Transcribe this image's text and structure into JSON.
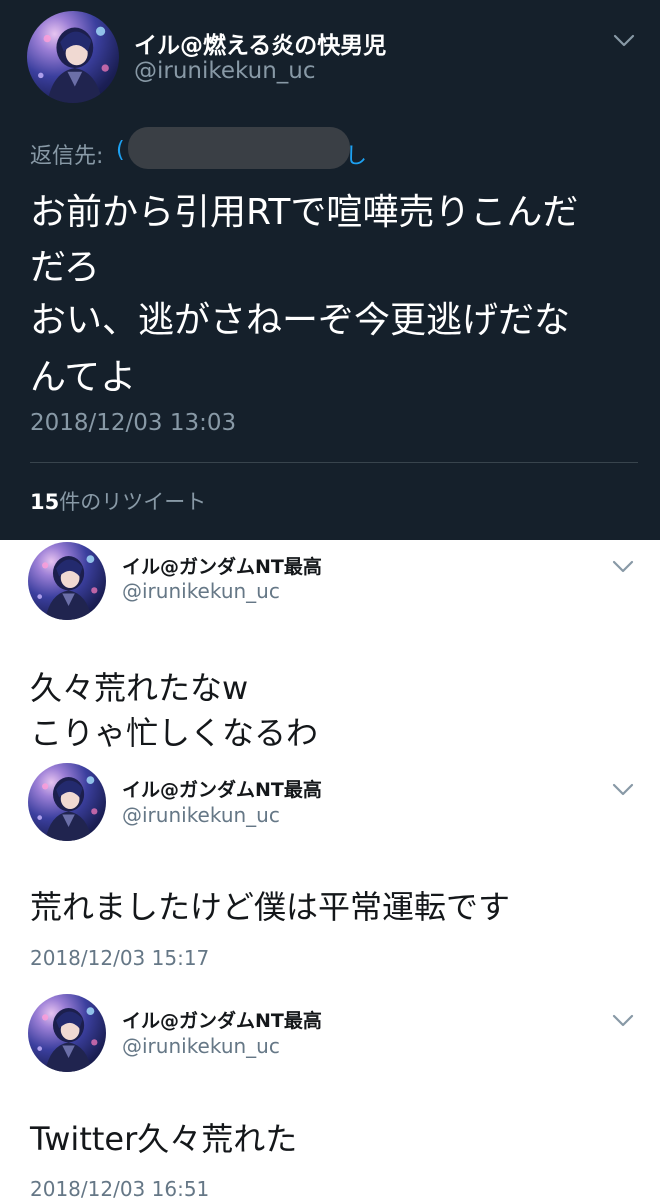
{
  "tweets": [
    {
      "display_name": "イル@燃える炎の快男児",
      "handle": "@irunikekun_uc",
      "reply_label": "返信先:",
      "reply_paren_open": "(",
      "reply_end": "し",
      "lines": [
        "お前から引用RTで喧嘩売りこんだ",
        "だろ",
        "おい、逃がさねーぞ今更逃げだな",
        "んてよ"
      ],
      "timestamp": "2018/12/03 13:03",
      "retweet_count": "15",
      "retweet_label": "件のリツイート"
    },
    {
      "display_name": "イル@ガンダムNT最高",
      "handle": "@irunikekun_uc",
      "lines": [
        "久々荒れたなw",
        "こりゃ忙しくなるわ"
      ]
    },
    {
      "display_name": "イル@ガンダムNT最高",
      "handle": "@irunikekun_uc",
      "lines": [
        "荒れましたけど僕は平常運転です"
      ],
      "timestamp": "2018/12/03 15:17"
    },
    {
      "display_name": "イル@ガンダムNT最高",
      "handle": "@irunikekun_uc",
      "lines": [
        "Twitter久々荒れた"
      ],
      "timestamp": "2018/12/03 16:51"
    }
  ],
  "icons": {
    "avatar": "user-avatar",
    "menu": "chevron-down-icon"
  },
  "colors": {
    "dark_bg": "#15202b",
    "link_blue": "#1da1f2",
    "muted": "#8899a6"
  }
}
